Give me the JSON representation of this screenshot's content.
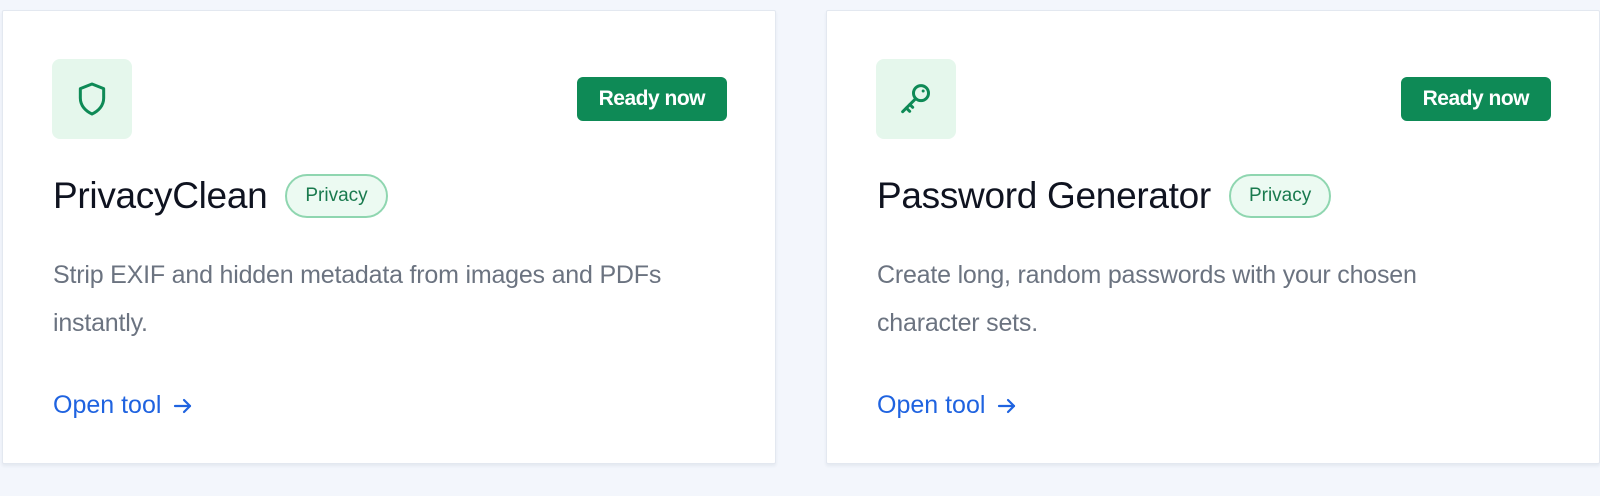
{
  "cards": [
    {
      "icon": "shield-icon",
      "title": "PrivacyClean",
      "category": "Privacy",
      "status": "Ready now",
      "description": "Strip EXIF and hidden metadata from images and PDFs instantly.",
      "link_label": "Open tool"
    },
    {
      "icon": "key-icon",
      "title": "Password Generator",
      "category": "Privacy",
      "status": "Ready now",
      "description": "Create long, random passwords with your chosen character sets.",
      "link_label": "Open tool"
    }
  ],
  "colors": {
    "accent_green": "#0e8a56",
    "icon_tile_bg": "#e5f7ec",
    "chip_border": "#8fd6b0",
    "link_blue": "#1f63e0",
    "page_bg": "#f3f6fc"
  }
}
